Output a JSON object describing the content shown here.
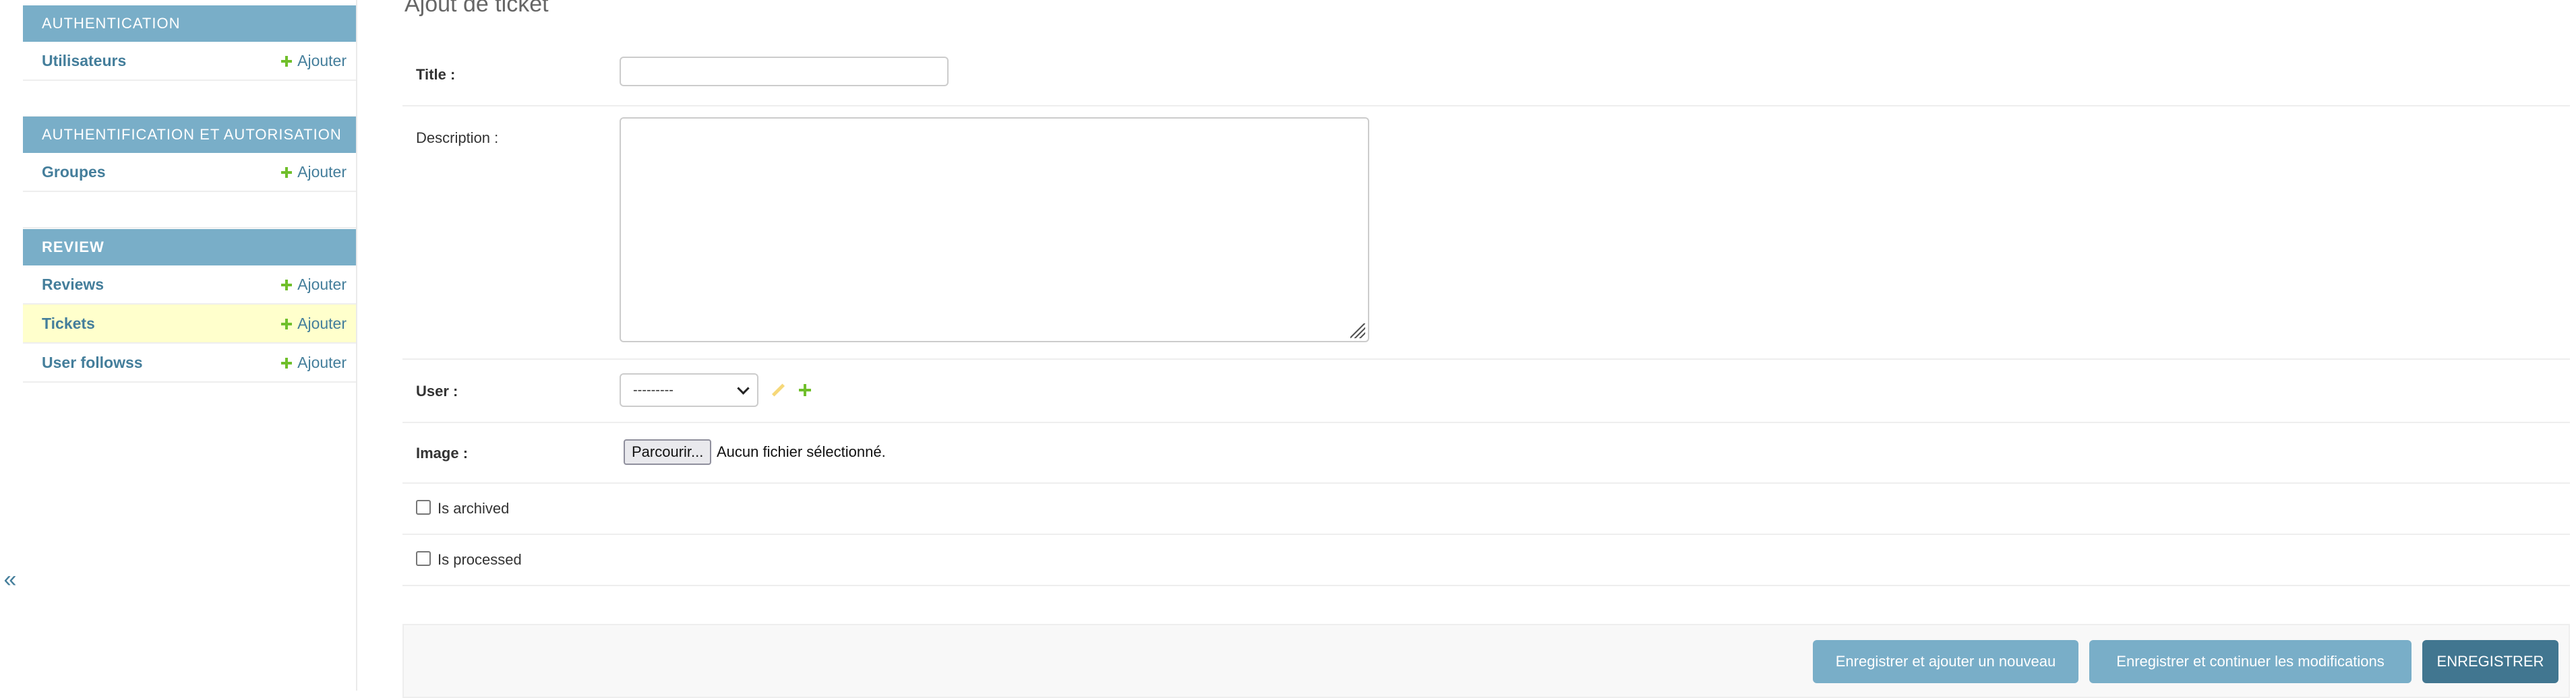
{
  "sidebar": {
    "toggle_icon": "«",
    "modules": [
      {
        "header": "AUTHENTICATION",
        "rows": [
          {
            "label": "Utilisateurs",
            "add_label": "Ajouter"
          }
        ]
      },
      {
        "header": "AUTHENTIFICATION ET AUTORISATION",
        "rows": [
          {
            "label": "Groupes",
            "add_label": "Ajouter"
          }
        ]
      },
      {
        "header": "REVIEW",
        "rows": [
          {
            "label": "Reviews",
            "add_label": "Ajouter"
          },
          {
            "label": "Tickets",
            "add_label": "Ajouter"
          },
          {
            "label": "User followss",
            "add_label": "Ajouter"
          }
        ]
      }
    ]
  },
  "main": {
    "title": "Ajout de ticket",
    "form": {
      "title_label": "Title :",
      "title_value": "",
      "description_label": "Description :",
      "description_value": "",
      "user_label": "User :",
      "user_selected": "---------",
      "image_label": "Image :",
      "file_button_label": "Parcourir...",
      "file_status": "Aucun fichier sélectionné.",
      "is_archived_label": "Is archived",
      "is_processed_label": "Is processed"
    },
    "submit": {
      "save_add_another": "Enregistrer et ajouter un nouveau",
      "save_continue": "Enregistrer et continuer les modifications",
      "save": "ENREGISTRER"
    }
  },
  "colors": {
    "module_header": "#79aec8",
    "link": "#447e9b",
    "add_icon": "#70bf2b",
    "current_row": "#ffffcc",
    "primary_button": "#417690",
    "secondary_button": "#79aec8"
  }
}
